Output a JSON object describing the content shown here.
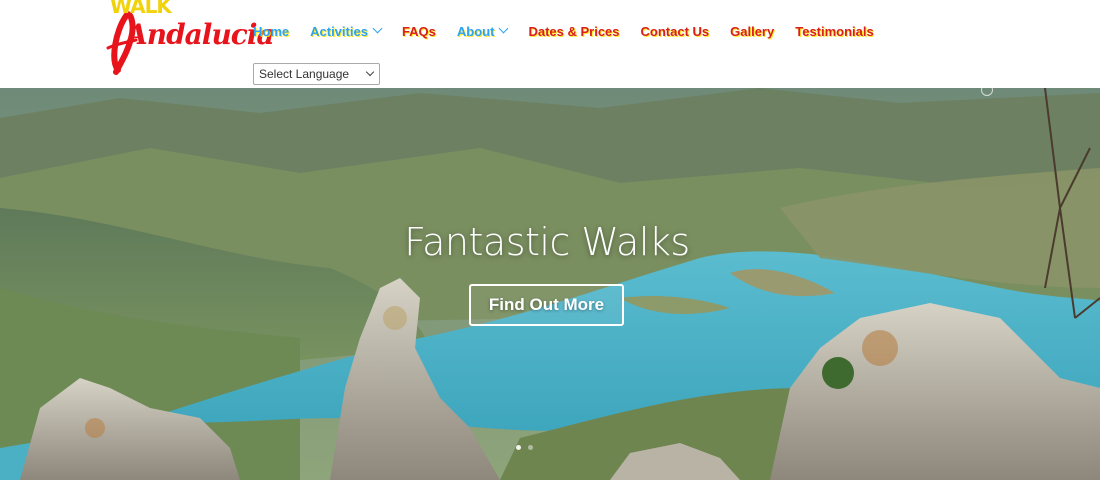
{
  "logo": {
    "walk": "WALK",
    "andalucia": "Andalucia"
  },
  "nav": {
    "items": [
      {
        "label": "Home",
        "has_dropdown": false,
        "color": "#2ea3f2"
      },
      {
        "label": "Activities",
        "has_dropdown": true,
        "color": "#2ea3f2"
      },
      {
        "label": "FAQs",
        "has_dropdown": false,
        "color": "#d81e1e"
      },
      {
        "label": "About",
        "has_dropdown": true,
        "color": "#2ea3f2"
      },
      {
        "label": "Dates & Prices",
        "has_dropdown": false,
        "color": "#d81e1e"
      },
      {
        "label": "Contact Us",
        "has_dropdown": false,
        "color": "#d81e1e"
      },
      {
        "label": "Gallery",
        "has_dropdown": false,
        "color": "#d81e1e"
      },
      {
        "label": "Testimonials",
        "has_dropdown": false,
        "color": "#d81e1e"
      }
    ]
  },
  "language_select": {
    "selected": "Select Language"
  },
  "hero": {
    "title": "Fantastic Walks",
    "button_label": "Find Out More",
    "slide_count": 2,
    "active_slide": 1
  },
  "colors": {
    "link_blue": "#2ea3f2",
    "link_red": "#d81e1e",
    "text_shadow_yellow": "#ffe600",
    "logo_red": "#e8141b",
    "logo_yellow": "#f2d20b",
    "lake": "#4fb2c6"
  }
}
